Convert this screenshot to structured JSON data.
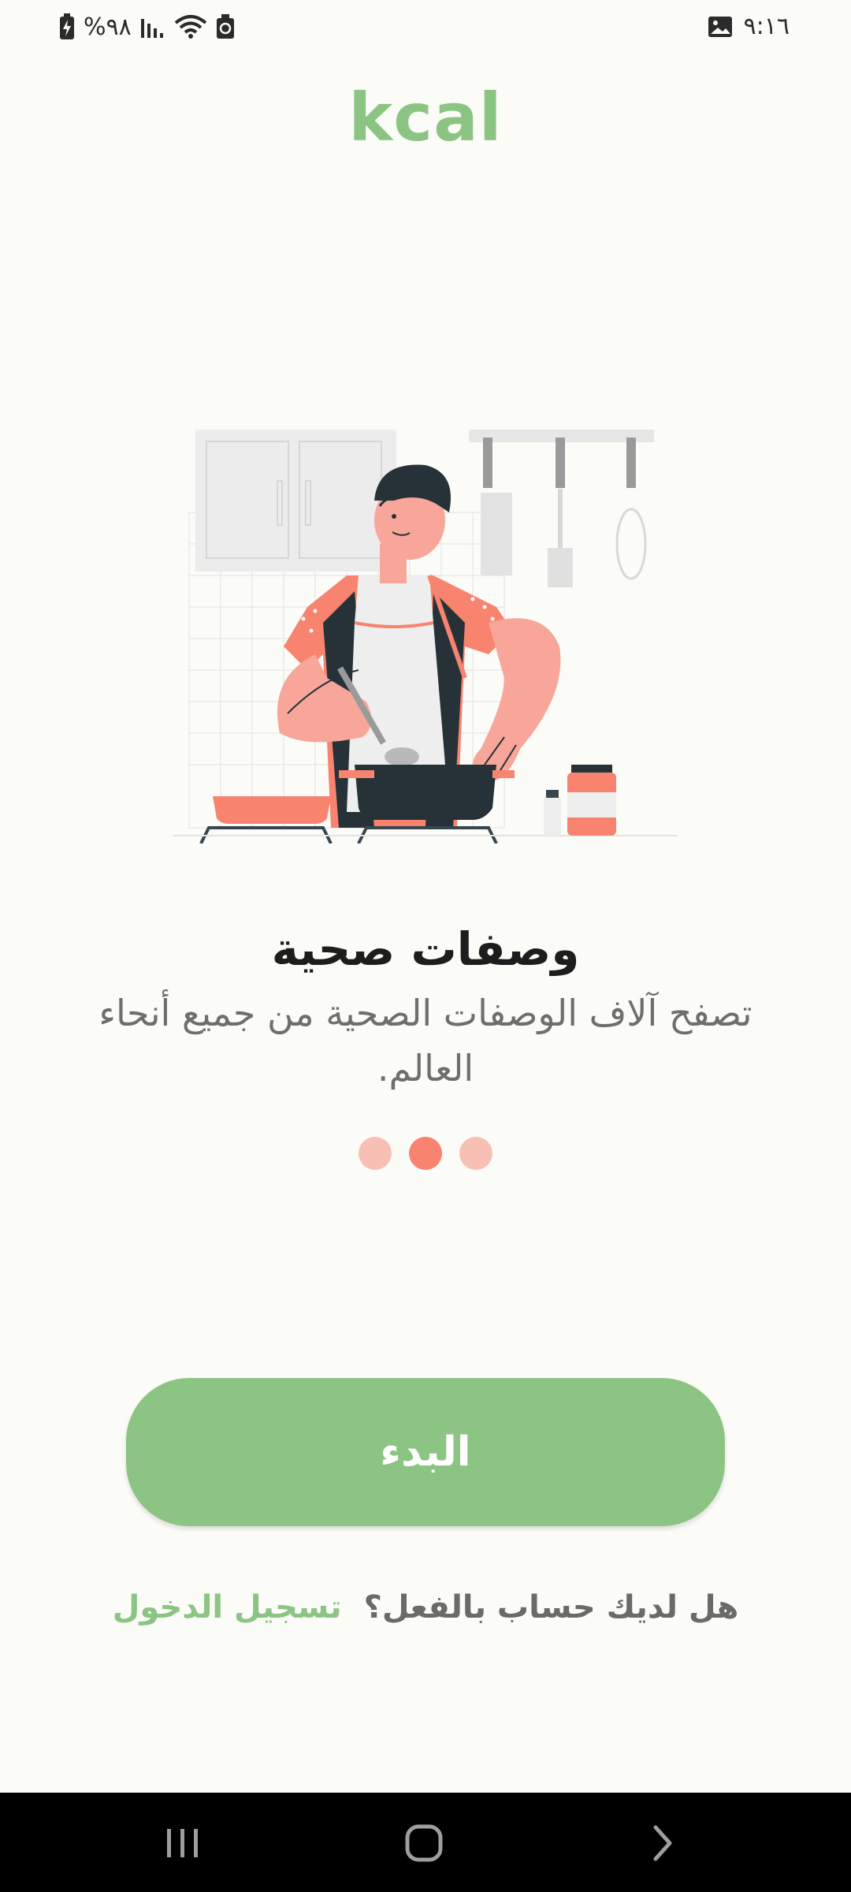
{
  "status_bar": {
    "battery_text": "%٩٨",
    "time": "٩:١٦",
    "left_icons": [
      "battery-charging-icon",
      "signal-icon",
      "wifi-icon",
      "recycle-icon"
    ],
    "right_icons": [
      "gallery-icon"
    ]
  },
  "app": {
    "logo": "kcal"
  },
  "onboarding": {
    "illustration": "chef-cooking-illustration",
    "title": "وصفات صحية",
    "subtitle": "تصفح آلاف الوصفات الصحية من جميع أنحاء العالم.",
    "page_indicator": {
      "count": 3,
      "active_index": 1
    }
  },
  "actions": {
    "start_label": "البدء",
    "login_question": "هل لديك حساب بالفعل؟",
    "login_link": "تسجيل الدخول"
  },
  "colors": {
    "brand_green": "#8bc483",
    "accent_coral": "#f8836f",
    "background": "#fbfbf7"
  },
  "nav_bar": {
    "icons": [
      "recents-icon",
      "home-icon",
      "back-icon"
    ]
  }
}
